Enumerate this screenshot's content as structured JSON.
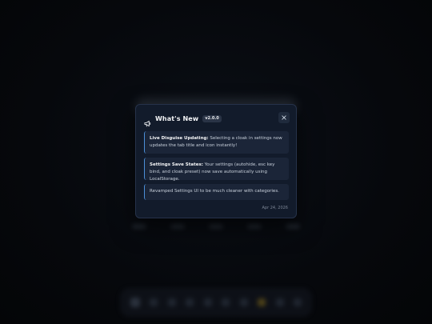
{
  "modal": {
    "title": "What's New",
    "version": "v2.0.0",
    "date": "Apr 24, 2026",
    "updates": [
      {
        "heading": "Live Disguise Updating:",
        "text": " Selecting a cloak in settings now updates the tab title and icon instantly!"
      },
      {
        "heading": "Settings Save States:",
        "text": " Your settings (autohide, esc key bind, and cloak preset) now save automatically using LocalStorage."
      },
      {
        "heading": "",
        "text": "Revamped Settings UI to be much cleaner with categories."
      }
    ],
    "icons": {
      "header": "megaphone-icon",
      "close": "close-icon"
    }
  },
  "colors": {
    "background": "#05070b",
    "modal_bg": "#121b2b",
    "card_bg": "#1b2538",
    "accent": "#4b8fd8",
    "title": "#f3f4f6",
    "muted": "#7c8696"
  }
}
